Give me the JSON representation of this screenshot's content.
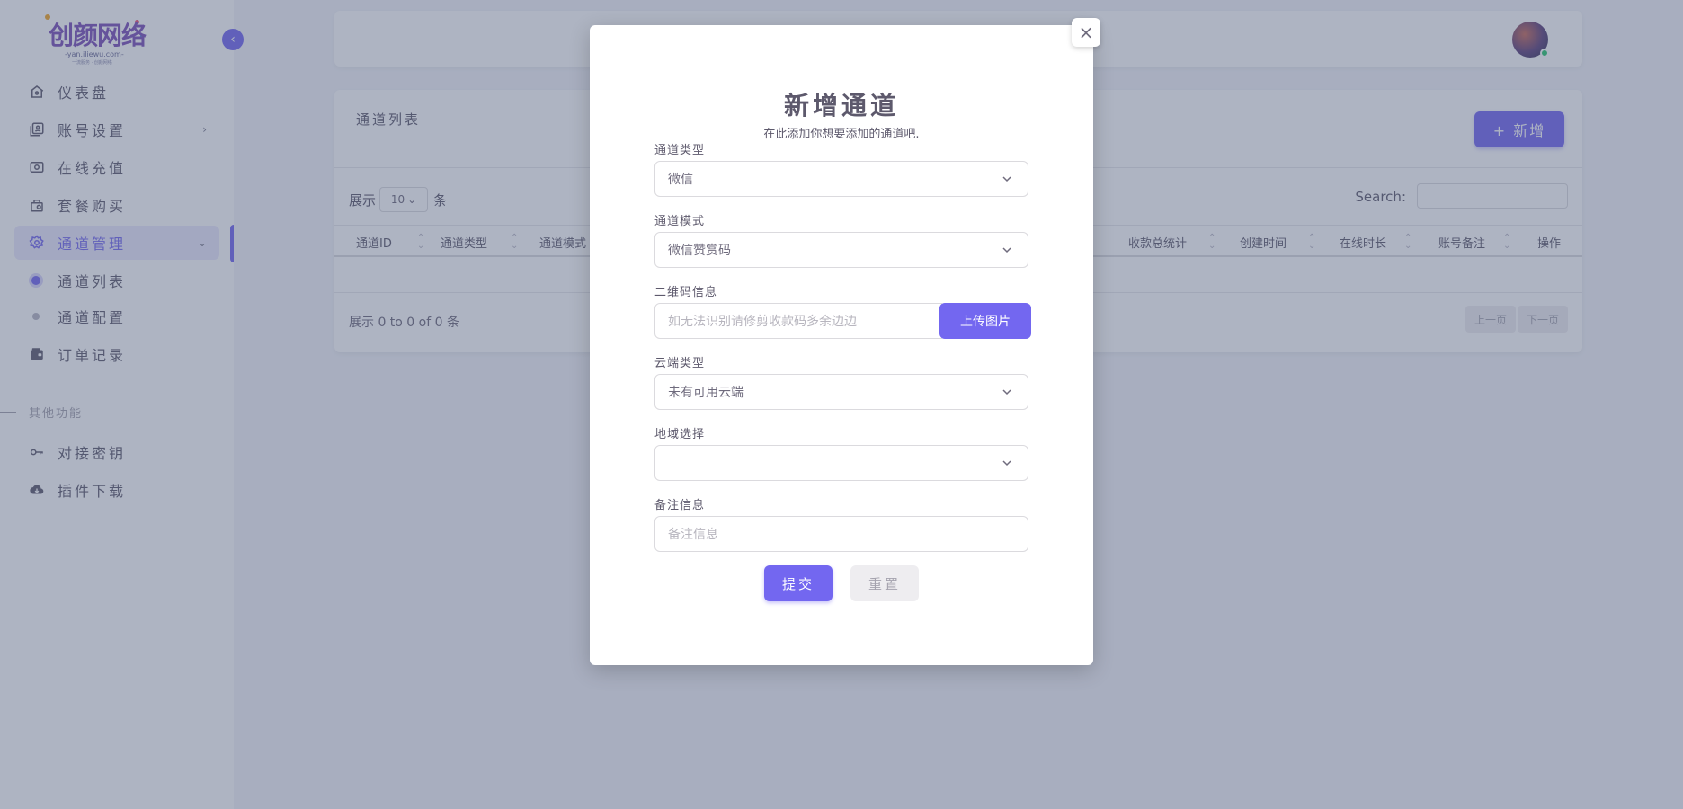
{
  "sidebar": {
    "logo_text": "创颜网络",
    "logo_sub": "-yan.iliewu.com-",
    "logo_sub2": "一流服务 · 创颜网络",
    "items": [
      {
        "label": "仪表盘",
        "icon": "home-icon"
      },
      {
        "label": "账号设置",
        "icon": "account-icon",
        "chevron": "›"
      },
      {
        "label": "在线充值",
        "icon": "recharge-icon"
      },
      {
        "label": "套餐购买",
        "icon": "package-icon"
      },
      {
        "label": "通道管理",
        "icon": "gear-icon",
        "chevron": "⌄"
      }
    ],
    "sub_items": [
      {
        "label": "通道列表"
      },
      {
        "label": "通道配置"
      }
    ],
    "order_item": {
      "label": "订单记录",
      "icon": "wallet-icon"
    },
    "section_label": "其他功能",
    "other_items": [
      {
        "label": "对接密钥",
        "icon": "key-icon"
      },
      {
        "label": "插件下载",
        "icon": "cloud-download-icon"
      }
    ]
  },
  "card": {
    "title": "通道列表",
    "add_label": "+ 新增",
    "show_prefix": "展示",
    "show_value": "10",
    "show_suffix": "条",
    "search_label": "Search:",
    "columns": [
      "通道ID",
      "通道类型",
      "通道模式",
      "收款总统计",
      "创建时间",
      "在线时长",
      "账号备注",
      "操作"
    ],
    "info": "展示 0 to 0 of 0 条",
    "prev": "上一页",
    "next": "下一页"
  },
  "modal": {
    "title": "新增通道",
    "subtitle": "在此添加你想要添加的通道吧.",
    "close": "×",
    "fields": {
      "channel_type": {
        "label": "通道类型",
        "value": "微信"
      },
      "channel_mode": {
        "label": "通道模式",
        "value": "微信赞赏码"
      },
      "qrcode": {
        "label": "二维码信息",
        "placeholder": "如无法识别请修剪收款码多余边边",
        "button": "上传图片"
      },
      "cloud_type": {
        "label": "云端类型",
        "value": "未有可用云端"
      },
      "region": {
        "label": "地域选择",
        "value": ""
      },
      "remark": {
        "label": "备注信息",
        "placeholder": "备注信息"
      }
    },
    "submit": "提交",
    "reset": "重置"
  },
  "colors": {
    "accent": "#7367f0",
    "overlay": "#4b5878"
  }
}
